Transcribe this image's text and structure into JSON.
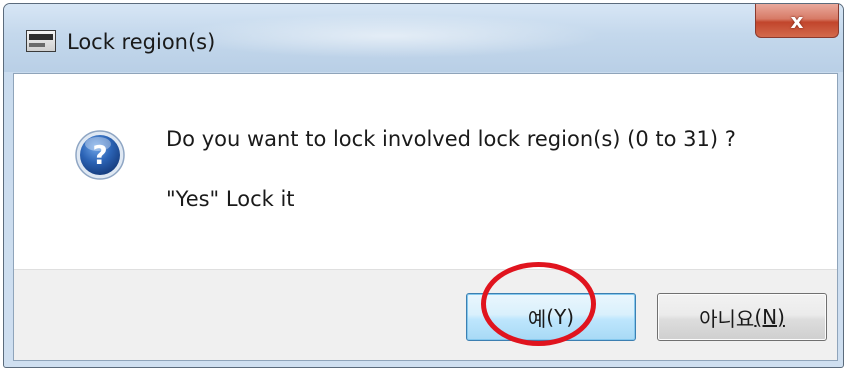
{
  "window": {
    "title": "Lock region(s)",
    "close_glyph": "x"
  },
  "dialog": {
    "icon": "question-icon",
    "message": "Do you want to lock involved lock region(s) (0 to 31) ?",
    "detail": "\"Yes\" Lock it"
  },
  "buttons": {
    "yes": {
      "label": "예",
      "accelerator": "(Y)"
    },
    "no": {
      "label": "아니요",
      "accelerator": "(N)"
    }
  },
  "annotation": {
    "highlight": "red-circle-around-yes-button",
    "color": "#e0141e"
  },
  "colors": {
    "titlebar": "#c4d8ec",
    "close_button": "#c1452c",
    "question_icon": "#2b63b5",
    "default_button": "#bee6fd"
  }
}
